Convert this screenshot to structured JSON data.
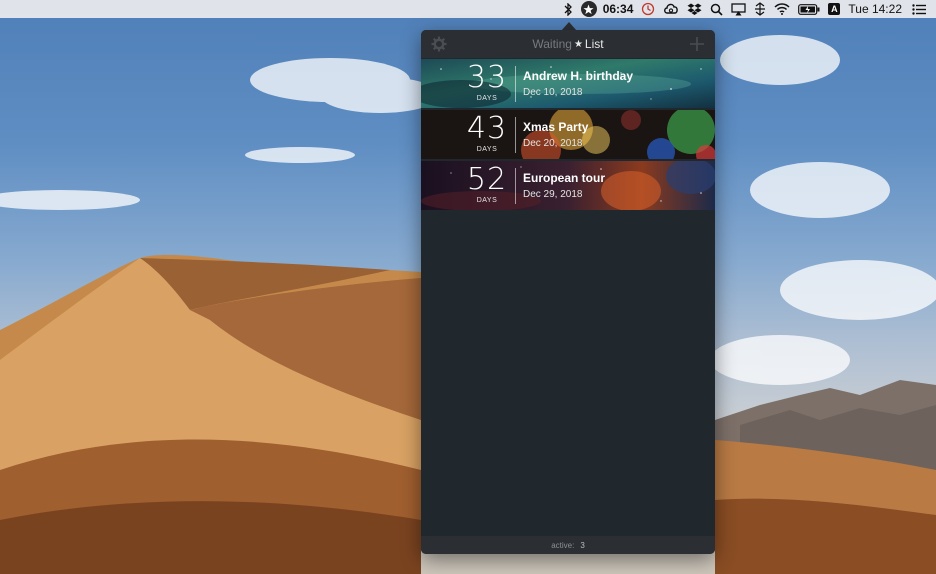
{
  "menubar": {
    "time_bold": "06:34",
    "clock": "Tue 14:22",
    "letter_badge": "A",
    "icons": [
      "bluetooth-icon",
      "star-icon",
      "timer-icon",
      "creative-cloud-icon",
      "dropbox-icon",
      "search-icon",
      "airplay-icon",
      "network-icon",
      "wifi-icon",
      "battery-icon",
      "notification-center-icon"
    ]
  },
  "popover": {
    "title_pre": "Waiting",
    "title_star": "★",
    "title_post": "List",
    "gear_icon": "gear-icon",
    "add_icon": "plus-icon",
    "events": [
      {
        "count": "33",
        "unit": "DAYS",
        "title": "Andrew H. birthday",
        "date": "Dec 10, 2018"
      },
      {
        "count": "43",
        "unit": "DAYS",
        "title": "Xmas Party",
        "date": "Dec 20, 2018"
      },
      {
        "count": "52",
        "unit": "DAYS",
        "title": "European tour",
        "date": "Dec 29, 2018"
      }
    ],
    "footer": {
      "label": "active:",
      "value": "3"
    }
  },
  "colors": {
    "popover_bg": "#20272d",
    "header_bg": "#2b2e32",
    "text_primary": "#ffffff",
    "text_muted": "#777b80"
  }
}
